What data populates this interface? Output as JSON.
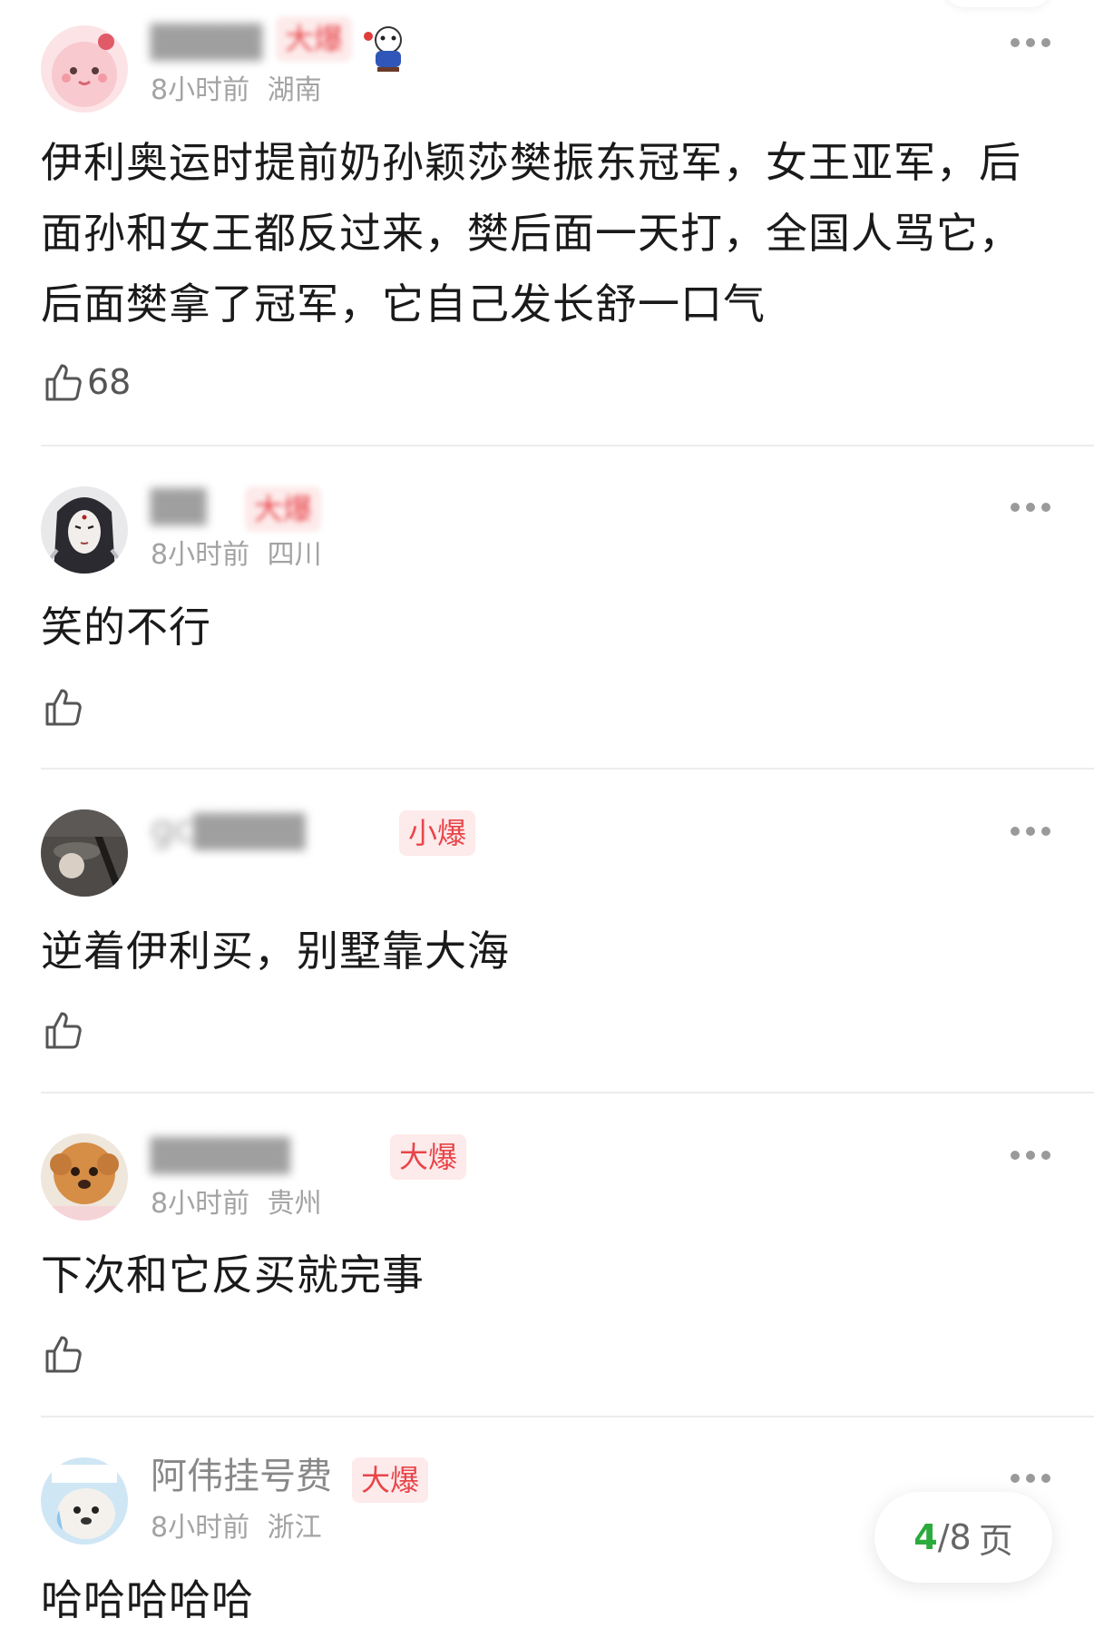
{
  "comments": [
    {
      "username": "▇▇▇▇",
      "badge": "大爆",
      "time": "8小时前",
      "location": "湖南",
      "content": "伊利奥运时提前奶孙颖莎樊振东冠军，女王亚军，后面孙和女王都反过来，樊后面一天打，全国人骂它，后面樊拿了冠军，它自己发长舒一口气",
      "likes": "68"
    },
    {
      "username": "▇▇",
      "badge": "大爆",
      "time": "8小时前",
      "location": "四川",
      "content": "笑的不行",
      "likes": ""
    },
    {
      "username": "gc▇▇▇▇",
      "badge": "小爆",
      "time": "",
      "location": "",
      "content": "逆着伊利买，别墅靠大海",
      "likes": ""
    },
    {
      "username": "▇▇▇▇▇",
      "badge": "大爆",
      "time": "8小时前",
      "location": "贵州",
      "content": "下次和它反买就完事",
      "likes": ""
    },
    {
      "username": "阿伟挂号费",
      "badge": "大爆",
      "time": "8小时前",
      "location": "浙江",
      "content": "哈哈哈哈哈",
      "likes": ""
    }
  ],
  "pagination": {
    "current": "4",
    "separator": "/",
    "total": "8",
    "suffix": "页"
  },
  "icons": {
    "more": "more-dots-icon",
    "like": "thumbs-up-icon"
  },
  "colors": {
    "badge_text": "#e8454a",
    "badge_bg": "#fdeaea",
    "page_current": "#2bab3e",
    "meta_text": "#a3a3a3"
  }
}
